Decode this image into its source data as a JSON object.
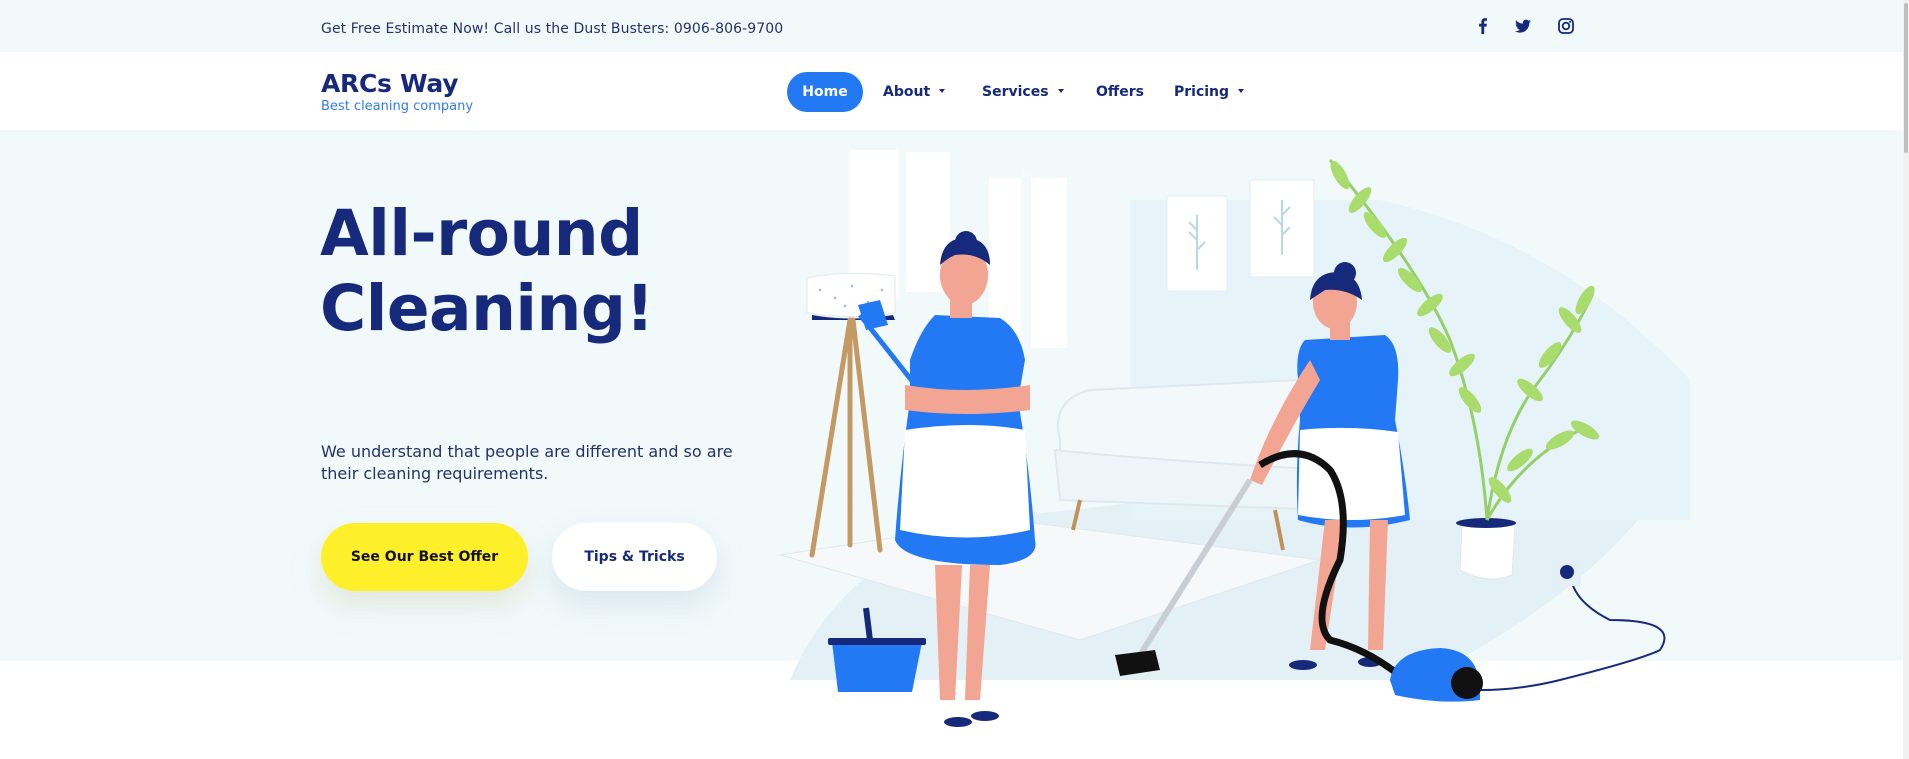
{
  "topbar": {
    "text": "Get Free Estimate Now! Call us the Dust Busters: 0906-806-9700",
    "social_icons": [
      "facebook-icon",
      "twitter-icon",
      "instagram-icon"
    ]
  },
  "brand": {
    "name": "ARCs Way",
    "tagline": "Best cleaning company"
  },
  "nav": {
    "items": [
      {
        "label": "Home",
        "active": true,
        "dropdown": false
      },
      {
        "label": "About",
        "active": false,
        "dropdown": true
      },
      {
        "label": "Services",
        "active": false,
        "dropdown": true
      },
      {
        "label": "Offers",
        "active": false,
        "dropdown": false
      },
      {
        "label": "Pricing",
        "active": false,
        "dropdown": true
      }
    ]
  },
  "hero": {
    "title_line1": "All-round",
    "title_line2": "Cleaning!",
    "description": "We understand that people are different and so are their cleaning requirements.",
    "primary_button": "See Our Best Offer",
    "secondary_button": "Tips & Tricks"
  },
  "colors": {
    "navy": "#16297a",
    "accent_blue": "#2378f3",
    "hero_bg": "#f1f9fb",
    "yellow": "#fdf02a"
  }
}
